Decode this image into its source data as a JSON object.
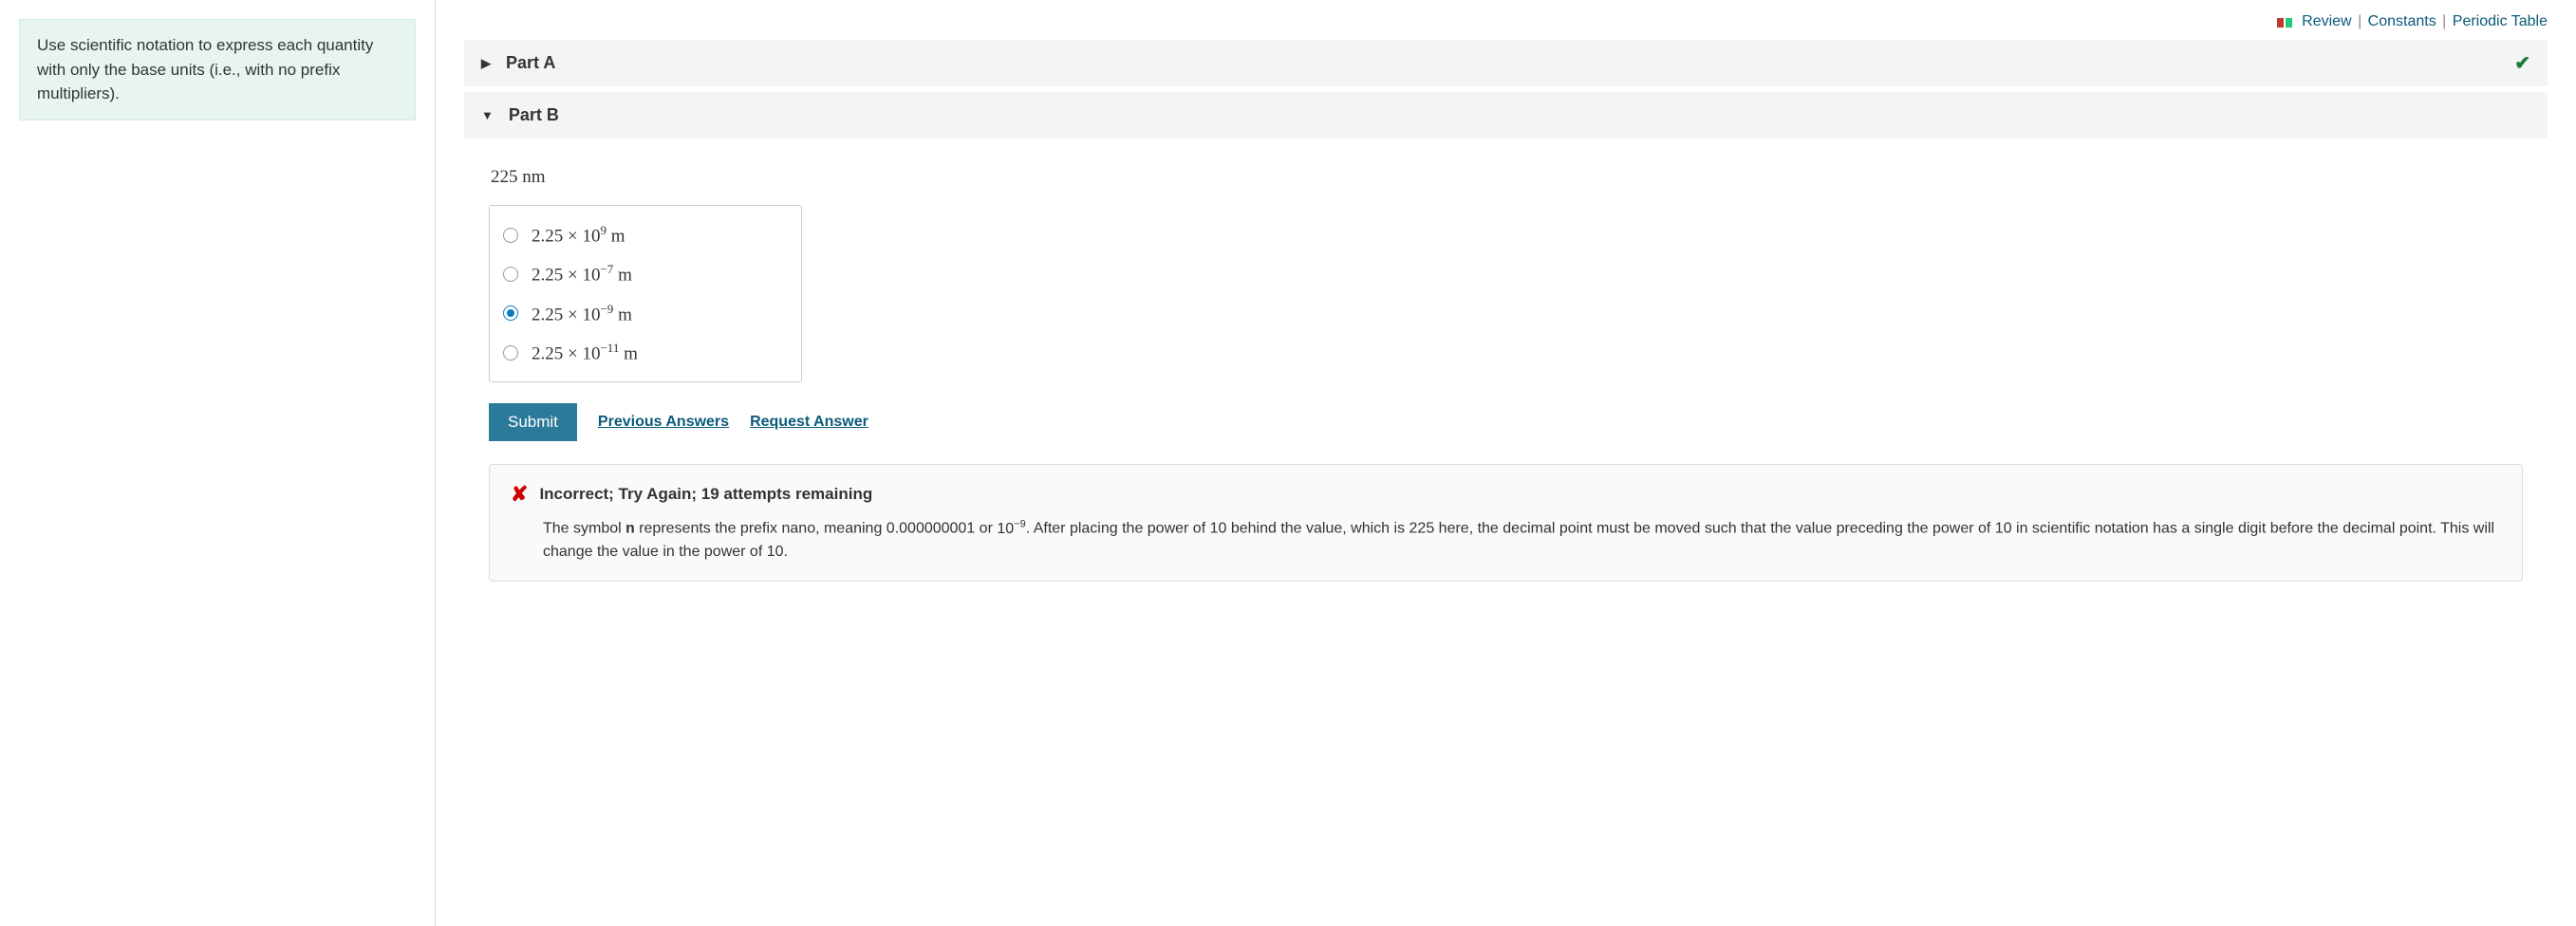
{
  "instruction": "Use scientific notation to express each quantity with only the base units (i.e., with no prefix multipliers).",
  "topLinks": {
    "review": "Review",
    "constants": "Constants",
    "periodic": "Periodic Table"
  },
  "partA": {
    "label": "Part A",
    "complete": true
  },
  "partB": {
    "label": "Part B",
    "question": "225 nm",
    "options": [
      {
        "coef": "2.25",
        "exp": "9",
        "unit": "m",
        "selected": false
      },
      {
        "coef": "2.25",
        "exp": "−7",
        "unit": "m",
        "selected": false
      },
      {
        "coef": "2.25",
        "exp": "−9",
        "unit": "m",
        "selected": true
      },
      {
        "coef": "2.25",
        "exp": "−11",
        "unit": "m",
        "selected": false
      }
    ],
    "actions": {
      "submit": "Submit",
      "previous": "Previous Answers",
      "request": "Request Answer"
    },
    "feedback": {
      "title": "Incorrect; Try Again; 19 attempts remaining",
      "symbol": "n",
      "decimalVal": "0.000000001",
      "exp": "−9",
      "value": "225",
      "text1": "The symbol ",
      "text2": " represents the prefix nano, meaning ",
      "text3": " or ",
      "text4": ".  After placing the power of 10 behind the value, which is ",
      "text5": " here, the decimal point must be moved such that the value preceding the power of 10 in scientific notation has a single digit before the decimal point. This will change the value in the power of 10."
    }
  }
}
